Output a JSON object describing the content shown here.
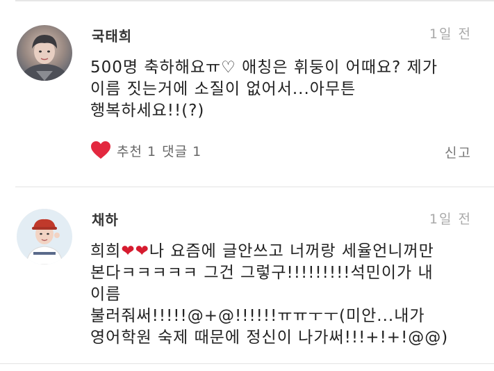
{
  "comments": [
    {
      "username": "국태희",
      "time": "1일 전",
      "lines": [
        "500명 축하해요ㅠ♡ 애칭은 휘둥이 어때요? 제가",
        "이름 짓는거에 소질이 없어서...아무튼",
        "행복하세요!!(?)"
      ],
      "likes_label": "추천 1",
      "replies_label": "댓글 1",
      "report_label": "신고",
      "like_color": "#e3283f"
    },
    {
      "username": "채하",
      "time": "1일 전",
      "line1_pre": "희희",
      "line1_hearts": "❤❤",
      "line1_post": "나 요즘에 글안쓰고 너꺼랑 세율언니꺼만",
      "lines": [
        "본다ㅋㅋㅋㅋㅋ 그건 그렇구!!!!!!!!!석민이가 내",
        "이름",
        "불러줘써!!!!!@+@!!!!!!ㅠㅠㅜㅜ(미안...내가",
        "영어학원 숙제 때문에 정신이 나가써!!!+!+!@@)"
      ]
    }
  ]
}
